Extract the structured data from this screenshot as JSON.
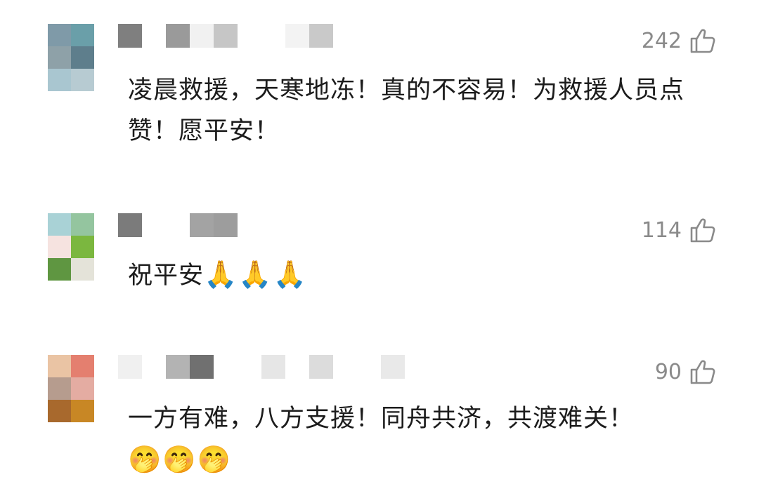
{
  "comments": [
    {
      "likes": "242",
      "text": "凌晨救援，天寒地冻！真的不容易！为救援人员点赞！愿平安！",
      "avatar_colors": [
        "#7f9aa8",
        "#6a9fa9",
        "#8ea1a8",
        "#5e7e8c",
        "#a9c6d0",
        "#b7cbd2"
      ],
      "name_blocks": [
        "#7f7f7f",
        "#9a9a9a",
        "#f1f1f1",
        "#c6c6c6",
        "#d6d6d6"
      ]
    },
    {
      "likes": "114",
      "text": "祝平安",
      "emojis": "🙏🙏🙏",
      "avatar_colors": [
        "#a9d2d6",
        "#94c59f",
        "#f6e3e0",
        "#7bb73f",
        "#5f9641",
        "#e4e3d9"
      ],
      "name_blocks": [
        "#7b7b7b",
        "#9d9d9d"
      ]
    },
    {
      "likes": "90",
      "text": "一方有难，八方支援！同舟共济，共渡难关！",
      "emojis": "🤭🤭🤭",
      "avatar_colors": [
        "#eac4a4",
        "#e47f6f",
        "#b69c8e",
        "#e4aca2",
        "#a8692d",
        "#c88725"
      ],
      "name_blocks": [
        "#f0f0f0",
        "#b3b3b3",
        "#707070",
        "#e6e6e6",
        "#dcdcdc",
        "#e9e9e9"
      ]
    }
  ],
  "colors": {
    "like_gray": "#8a8a8a",
    "text": "#1c1c1c"
  },
  "icons": {
    "like": "thumbs-up-outline-icon"
  }
}
